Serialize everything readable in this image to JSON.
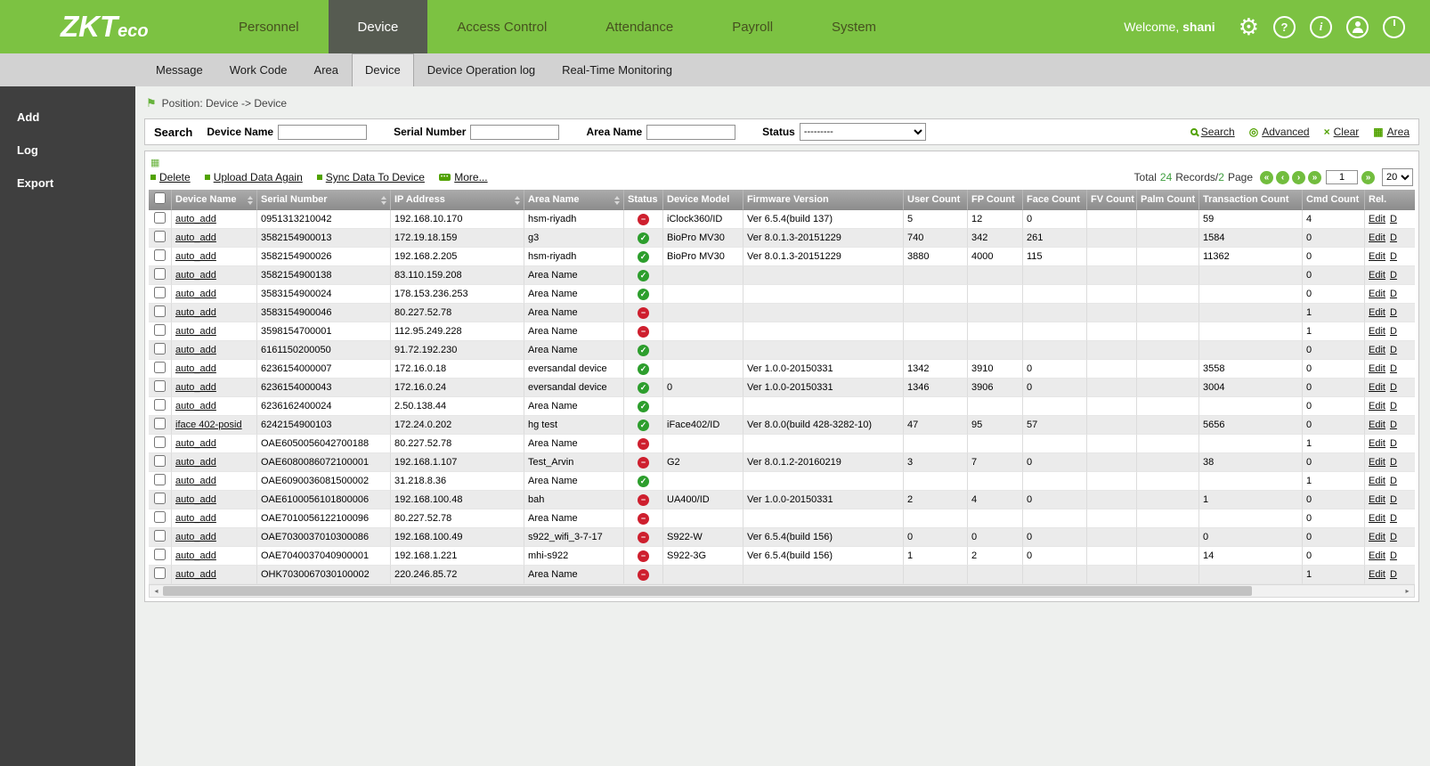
{
  "colors": {
    "brand_green": "#7cc242",
    "active_tab": "#565b51",
    "status_online": "#2d9e2d",
    "status_offline": "#ce1f2e",
    "link_green": "#51a200"
  },
  "header": {
    "logo_main": "ZKT",
    "logo_sub": "eco",
    "nav": [
      {
        "label": "Personnel",
        "active": false
      },
      {
        "label": "Device",
        "active": true
      },
      {
        "label": "Access Control",
        "active": false
      },
      {
        "label": "Attendance",
        "active": false
      },
      {
        "label": "Payroll",
        "active": false
      },
      {
        "label": "System",
        "active": false
      }
    ],
    "welcome": "Welcome,",
    "username": "shani",
    "icons": [
      "gear-icon",
      "help-icon",
      "info-icon",
      "user-icon",
      "power-icon"
    ]
  },
  "subnav": {
    "tabs": [
      {
        "label": "Message",
        "active": false
      },
      {
        "label": "Work Code",
        "active": false
      },
      {
        "label": "Area",
        "active": false
      },
      {
        "label": "Device",
        "active": true
      },
      {
        "label": "Device Operation log",
        "active": false
      },
      {
        "label": "Real-Time Monitoring",
        "active": false
      }
    ]
  },
  "sidebar": {
    "items": [
      {
        "label": "Add"
      },
      {
        "label": "Log"
      },
      {
        "label": "Export"
      }
    ]
  },
  "breadcrumb": {
    "icon": "flag-icon",
    "label": "Position: Device -> Device"
  },
  "search": {
    "title": "Search",
    "fields": [
      {
        "label": "Device Name",
        "value": ""
      },
      {
        "label": "Serial Number",
        "value": ""
      },
      {
        "label": "Area Name",
        "value": ""
      }
    ],
    "status_label": "Status",
    "status_value": "---------",
    "links": [
      {
        "label": "Search",
        "icon": "search-icon"
      },
      {
        "label": "Advanced",
        "icon": "advanced-icon"
      },
      {
        "label": "Clear",
        "icon": "clear-icon"
      },
      {
        "label": "Area",
        "icon": "area-icon"
      }
    ]
  },
  "toolbar": {
    "grid_icon": "grid-icon",
    "actions": [
      {
        "label": "Delete",
        "icon": "bullet-icon"
      },
      {
        "label": "Upload Data Again",
        "icon": "bullet-icon"
      },
      {
        "label": "Sync Data To Device",
        "icon": "bullet-icon"
      },
      {
        "label": "More...",
        "icon": "more-icon"
      }
    ],
    "pagination": {
      "total_prefix": "Total",
      "total_records": "24",
      "records_label": "Records/",
      "total_pages": "2",
      "pages_label": "Page",
      "page_value": "1",
      "page_size": "20",
      "buttons": [
        "first-page",
        "prev-page",
        "next-page",
        "last-page",
        "go-page"
      ]
    }
  },
  "table": {
    "columns": [
      {
        "key": "name",
        "label": "Device Name",
        "sortable": true
      },
      {
        "key": "serial",
        "label": "Serial Number",
        "sortable": true
      },
      {
        "key": "ip",
        "label": "IP Address",
        "sortable": true
      },
      {
        "key": "area",
        "label": "Area Name",
        "sortable": true
      },
      {
        "key": "status",
        "label": "Status"
      },
      {
        "key": "model",
        "label": "Device Model"
      },
      {
        "key": "firmware",
        "label": "Firmware Version"
      },
      {
        "key": "user",
        "label": "User Count"
      },
      {
        "key": "fp",
        "label": "FP Count"
      },
      {
        "key": "face",
        "label": "Face Count"
      },
      {
        "key": "fv",
        "label": "FV Count"
      },
      {
        "key": "palm",
        "label": "Palm Count"
      },
      {
        "key": "trans",
        "label": "Transaction Count"
      },
      {
        "key": "cmd",
        "label": "Cmd Count"
      },
      {
        "key": "actions",
        "label": "Rel."
      }
    ],
    "row_actions": [
      "Edit",
      "D"
    ],
    "rows": [
      {
        "name": "auto_add",
        "serial": "0951313210042",
        "ip": "192.168.10.170",
        "area": "hsm-riyadh",
        "status": "offline",
        "model": "iClock360/ID",
        "firmware": "Ver 6.5.4(build 137)",
        "user": "5",
        "fp": "12",
        "face": "0",
        "fv": "",
        "palm": "",
        "trans": "59",
        "cmd": "4"
      },
      {
        "name": "auto_add",
        "serial": "3582154900013",
        "ip": "172.19.18.159",
        "area": "g3",
        "status": "online",
        "model": "BioPro MV30",
        "firmware": "Ver 8.0.1.3-20151229",
        "user": "740",
        "fp": "342",
        "face": "261",
        "fv": "",
        "palm": "",
        "trans": "1584",
        "cmd": "0"
      },
      {
        "name": "auto_add",
        "serial": "3582154900026",
        "ip": "192.168.2.205",
        "area": "hsm-riyadh",
        "status": "online",
        "model": "BioPro MV30",
        "firmware": "Ver 8.0.1.3-20151229",
        "user": "3880",
        "fp": "4000",
        "face": "115",
        "fv": "",
        "palm": "",
        "trans": "11362",
        "cmd": "0"
      },
      {
        "name": "auto_add",
        "serial": "3582154900138",
        "ip": "83.110.159.208",
        "area": "Area Name",
        "status": "online",
        "model": "",
        "firmware": "",
        "user": "",
        "fp": "",
        "face": "",
        "fv": "",
        "palm": "",
        "trans": "",
        "cmd": "0"
      },
      {
        "name": "auto_add",
        "serial": "3583154900024",
        "ip": "178.153.236.253",
        "area": "Area Name",
        "status": "online",
        "model": "",
        "firmware": "",
        "user": "",
        "fp": "",
        "face": "",
        "fv": "",
        "palm": "",
        "trans": "",
        "cmd": "0"
      },
      {
        "name": "auto_add",
        "serial": "3583154900046",
        "ip": "80.227.52.78",
        "area": "Area Name",
        "status": "offline",
        "model": "",
        "firmware": "",
        "user": "",
        "fp": "",
        "face": "",
        "fv": "",
        "palm": "",
        "trans": "",
        "cmd": "1"
      },
      {
        "name": "auto_add",
        "serial": "3598154700001",
        "ip": "112.95.249.228",
        "area": "Area Name",
        "status": "offline",
        "model": "",
        "firmware": "",
        "user": "",
        "fp": "",
        "face": "",
        "fv": "",
        "palm": "",
        "trans": "",
        "cmd": "1"
      },
      {
        "name": "auto_add",
        "serial": "6161150200050",
        "ip": "91.72.192.230",
        "area": "Area Name",
        "status": "online",
        "model": "",
        "firmware": "",
        "user": "",
        "fp": "",
        "face": "",
        "fv": "",
        "palm": "",
        "trans": "",
        "cmd": "0"
      },
      {
        "name": "auto_add",
        "serial": "6236154000007",
        "ip": "172.16.0.18",
        "area": "eversandal device",
        "status": "online",
        "model": "",
        "firmware": "Ver 1.0.0-20150331",
        "user": "1342",
        "fp": "3910",
        "face": "0",
        "fv": "",
        "palm": "",
        "trans": "3558",
        "cmd": "0"
      },
      {
        "name": "auto_add",
        "serial": "6236154000043",
        "ip": "172.16.0.24",
        "area": "eversandal device",
        "status": "online",
        "model": "0",
        "firmware": "Ver 1.0.0-20150331",
        "user": "1346",
        "fp": "3906",
        "face": "0",
        "fv": "",
        "palm": "",
        "trans": "3004",
        "cmd": "0"
      },
      {
        "name": "auto_add",
        "serial": "6236162400024",
        "ip": "2.50.138.44",
        "area": "Area Name",
        "status": "online",
        "model": "",
        "firmware": "",
        "user": "",
        "fp": "",
        "face": "",
        "fv": "",
        "palm": "",
        "trans": "",
        "cmd": "0"
      },
      {
        "name": "iface 402-posid",
        "serial": "6242154900103",
        "ip": "172.24.0.202",
        "area": "hg test",
        "status": "online",
        "model": "iFace402/ID",
        "firmware": "Ver 8.0.0(build 428-3282-10)",
        "user": "47",
        "fp": "95",
        "face": "57",
        "fv": "",
        "palm": "",
        "trans": "5656",
        "cmd": "0"
      },
      {
        "name": "auto_add",
        "serial": "OAE6050056042700188",
        "ip": "80.227.52.78",
        "area": "Area Name",
        "status": "offline",
        "model": "",
        "firmware": "",
        "user": "",
        "fp": "",
        "face": "",
        "fv": "",
        "palm": "",
        "trans": "",
        "cmd": "1"
      },
      {
        "name": "auto_add",
        "serial": "OAE6080086072100001",
        "ip": "192.168.1.107",
        "area": "Test_Arvin",
        "status": "offline",
        "model": "G2",
        "firmware": "Ver 8.0.1.2-20160219",
        "user": "3",
        "fp": "7",
        "face": "0",
        "fv": "",
        "palm": "",
        "trans": "38",
        "cmd": "0"
      },
      {
        "name": "auto_add",
        "serial": "OAE6090036081500002",
        "ip": "31.218.8.36",
        "area": "Area Name",
        "status": "online",
        "model": "",
        "firmware": "",
        "user": "",
        "fp": "",
        "face": "",
        "fv": "",
        "palm": "",
        "trans": "",
        "cmd": "1"
      },
      {
        "name": "auto_add",
        "serial": "OAE6100056101800006",
        "ip": "192.168.100.48",
        "area": "bah",
        "status": "offline",
        "model": "UA400/ID",
        "firmware": "Ver 1.0.0-20150331",
        "user": "2",
        "fp": "4",
        "face": "0",
        "fv": "",
        "palm": "",
        "trans": "1",
        "cmd": "0"
      },
      {
        "name": "auto_add",
        "serial": "OAE7010056122100096",
        "ip": "80.227.52.78",
        "area": "Area Name",
        "status": "offline",
        "model": "",
        "firmware": "",
        "user": "",
        "fp": "",
        "face": "",
        "fv": "",
        "palm": "",
        "trans": "",
        "cmd": "0"
      },
      {
        "name": "auto_add",
        "serial": "OAE7030037010300086",
        "ip": "192.168.100.49",
        "area": "s922_wifi_3-7-17",
        "status": "offline",
        "model": "S922-W",
        "firmware": "Ver 6.5.4(build 156)",
        "user": "0",
        "fp": "0",
        "face": "0",
        "fv": "",
        "palm": "",
        "trans": "0",
        "cmd": "0"
      },
      {
        "name": "auto_add",
        "serial": "OAE7040037040900001",
        "ip": "192.168.1.221",
        "area": "mhi-s922",
        "status": "offline",
        "model": "S922-3G",
        "firmware": "Ver 6.5.4(build 156)",
        "user": "1",
        "fp": "2",
        "face": "0",
        "fv": "",
        "palm": "",
        "trans": "14",
        "cmd": "0"
      },
      {
        "name": "auto_add",
        "serial": "OHK7030067030100002",
        "ip": "220.246.85.72",
        "area": "Area Name",
        "status": "offline",
        "model": "",
        "firmware": "",
        "user": "",
        "fp": "",
        "face": "",
        "fv": "",
        "palm": "",
        "trans": "",
        "cmd": "1"
      }
    ]
  }
}
